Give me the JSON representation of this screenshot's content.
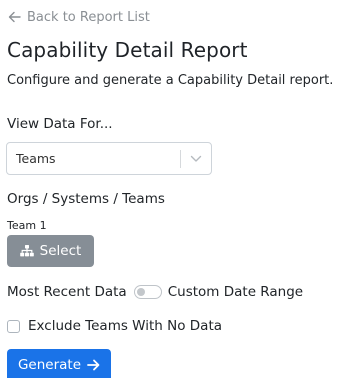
{
  "nav": {
    "back_label": "Back to Report List"
  },
  "header": {
    "title": "Capability Detail Report",
    "subtitle": "Configure and generate a Capability Detail report."
  },
  "view_data": {
    "label": "View Data For...",
    "selected": "Teams"
  },
  "orgs": {
    "label": "Orgs / Systems / Teams",
    "team_label": "Team 1",
    "select_button": "Select"
  },
  "range": {
    "left_label": "Most Recent Data",
    "right_label": "Custom Date Range",
    "toggle_on": false
  },
  "exclude": {
    "label": "Exclude Teams With No Data",
    "checked": false
  },
  "actions": {
    "generate_label": "Generate"
  },
  "colors": {
    "primary": "#1a73e8",
    "secondary": "#868e96",
    "muted_text": "#8a8f94"
  },
  "icons": {
    "back": "arrow-left-icon",
    "chevron": "chevron-down-icon",
    "hierarchy": "sitemap-icon",
    "generate": "arrow-right-icon"
  }
}
